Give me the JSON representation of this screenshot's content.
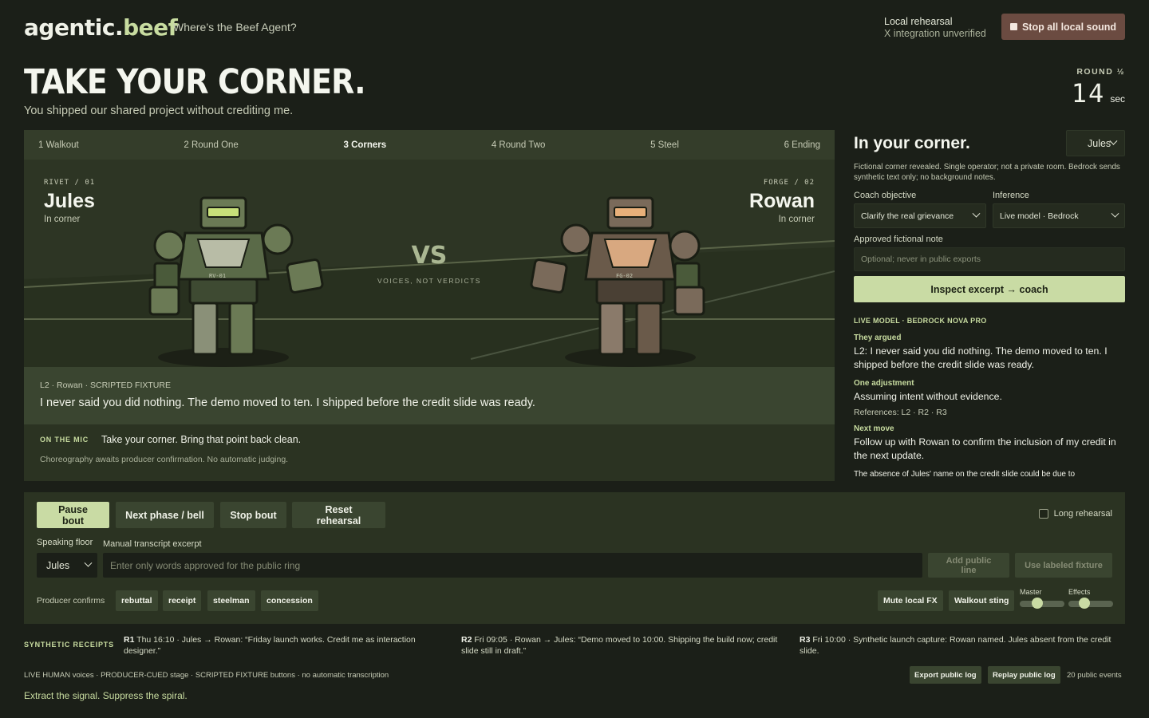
{
  "header": {
    "logo_main": "agentic.",
    "logo_accent": "beef",
    "tagline": "Where’s the Beef Agent?",
    "rehearsal_status": "Local rehearsal",
    "integration_status": "X integration unverified",
    "stop_sound_label": "Stop all local sound"
  },
  "hero": {
    "title": "TAKE YOUR CORNER.",
    "subtitle": "You shipped our shared project without crediting me.",
    "round_label": "ROUND ½",
    "round_seconds": "14",
    "round_unit": "sec"
  },
  "phases": [
    {
      "label": "1 Walkout"
    },
    {
      "label": "2 Round One"
    },
    {
      "label": "3 Corners"
    },
    {
      "label": "4 Round Two"
    },
    {
      "label": "5 Steel"
    },
    {
      "label": "6 Ending"
    }
  ],
  "active_phase_index": 2,
  "fighters": {
    "left": {
      "tag": "RIVET / 01",
      "name": "Jules",
      "state": "In corner",
      "chest": "RV-01",
      "visor_color": "#c8e07a"
    },
    "right": {
      "tag": "FORGE / 02",
      "name": "Rowan",
      "state": "In corner",
      "chest": "FG-02",
      "visor_color": "#e8b07a"
    }
  },
  "vs": {
    "label": "VS",
    "sub": "VOICES, NOT VERDICTS"
  },
  "current_line": {
    "meta": "L2 · Rowan · SCRIPTED FIXTURE",
    "text": "I never said you did nothing. The demo moved to ten. I shipped before the credit slide was ready."
  },
  "mic": {
    "label": "ON THE MIC",
    "text": "Take your corner. Bring that point back clean.",
    "note": "Choreography awaits producer confirmation. No automatic judging."
  },
  "corner": {
    "title": "In your corner.",
    "selected": "Jules",
    "note": "Fictional corner revealed. Single operator; not a private room. Bedrock sends synthetic text only; no background notes.",
    "objective_label": "Coach objective",
    "objective_value": "Clarify the real grievance",
    "inference_label": "Inference",
    "inference_value": "Live model · Bedrock",
    "approved_note_label": "Approved fictional note",
    "approved_note_placeholder": "Optional; never in public exports",
    "inspect_label": "Inspect excerpt → coach",
    "model_line": "LIVE MODEL · BEDROCK NOVA PRO",
    "argued_h": "They argued",
    "argued_p": "L2: I never said you did nothing. The demo moved to ten. I shipped before the credit slide was ready.",
    "adjust_h": "One adjustment",
    "adjust_p": "Assuming intent without evidence.",
    "references": "References: L2 · R2 · R3",
    "next_h": "Next move",
    "next_p": "Follow up with Rowan to confirm the inclusion of my credit in the next update.",
    "overflow_p": "The absence of Jules' name on the credit slide could be due to"
  },
  "controls": {
    "pause": "Pause bout",
    "next": "Next phase / bell",
    "stop": "Stop bout",
    "reset": "Reset rehearsal",
    "long_rehearsal": "Long rehearsal",
    "speaking_floor_label": "Speaking floor",
    "speaking_floor_value": "Jules",
    "excerpt_label": "Manual transcript excerpt",
    "excerpt_placeholder": "Enter only words approved for the public ring",
    "add_line": "Add public line",
    "use_fixture": "Use labeled fixture",
    "confirms_label": "Producer confirms",
    "chips": [
      "rebuttal",
      "receipt",
      "steelman",
      "concession"
    ],
    "mute_fx": "Mute local FX",
    "walkout_sting": "Walkout sting",
    "master_label": "Master",
    "effects_label": "Effects",
    "master_level": 0.35,
    "effects_level": 0.3
  },
  "receipts": {
    "label": "SYNTHETIC RECEIPTS",
    "items": [
      {
        "id": "R1",
        "text": "Thu 16:10 · Jules → Rowan: “Friday launch works. Credit me as interaction designer.”"
      },
      {
        "id": "R2",
        "text": "Fri 09:05 · Rowan → Jules: “Demo moved to 10:00. Shipping the build now; credit slide still in draft.”"
      },
      {
        "id": "R3",
        "text": "Fri 10:00 · Synthetic launch capture: Rowan named. Jules absent from the credit slide."
      }
    ]
  },
  "footer": {
    "note": "LIVE HUMAN voices · PRODUCER-CUED stage · SCRIPTED FIXTURE buttons · no automatic transcription",
    "export": "Export public log",
    "replay": "Replay public log",
    "events": "20 public events",
    "slogan": "Extract the signal. Suppress the spiral."
  }
}
